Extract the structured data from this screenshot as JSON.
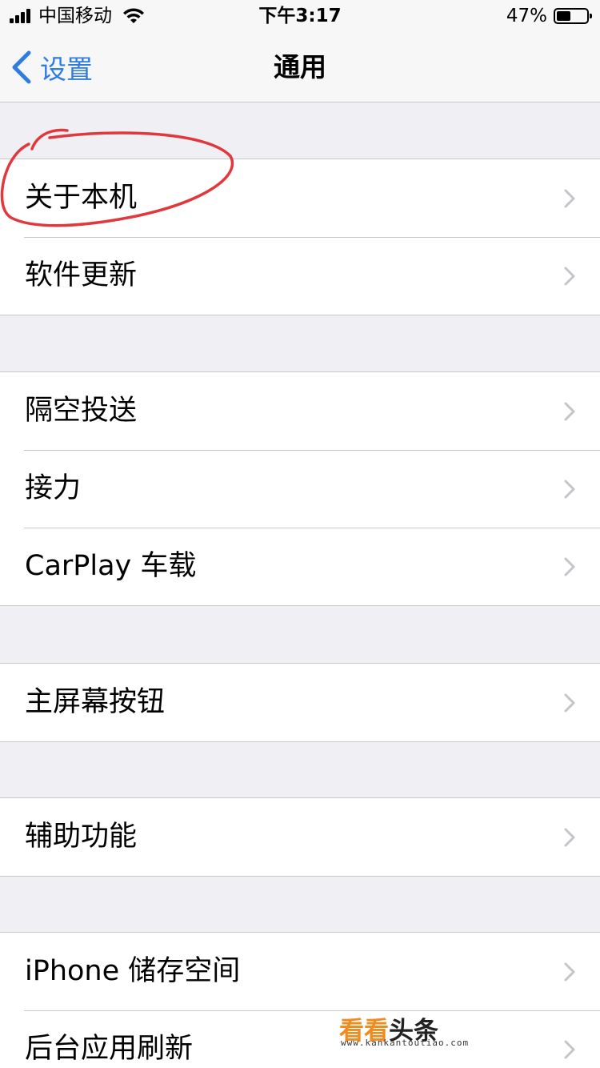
{
  "status_bar": {
    "carrier": "中国移动",
    "time": "下午3:17",
    "battery_percent": "47%",
    "battery_level": 0.47
  },
  "nav": {
    "back_label": "设置",
    "title": "通用"
  },
  "groups": [
    {
      "items": [
        {
          "label": "关于本机"
        },
        {
          "label": "软件更新"
        }
      ]
    },
    {
      "items": [
        {
          "label": "隔空投送"
        },
        {
          "label": "接力"
        },
        {
          "label": "CarPlay 车载"
        }
      ]
    },
    {
      "items": [
        {
          "label": "主屏幕按钮"
        }
      ]
    },
    {
      "items": [
        {
          "label": "辅助功能"
        }
      ]
    },
    {
      "items": [
        {
          "label": "iPhone 储存空间"
        },
        {
          "label": "后台应用刷新"
        }
      ]
    }
  ],
  "watermark": {
    "main_a": "看看",
    "main_b": "头条",
    "url": "www.kankantoutiao.com"
  },
  "colors": {
    "accent": "#2f7de1",
    "annotation": "#e0383c"
  }
}
